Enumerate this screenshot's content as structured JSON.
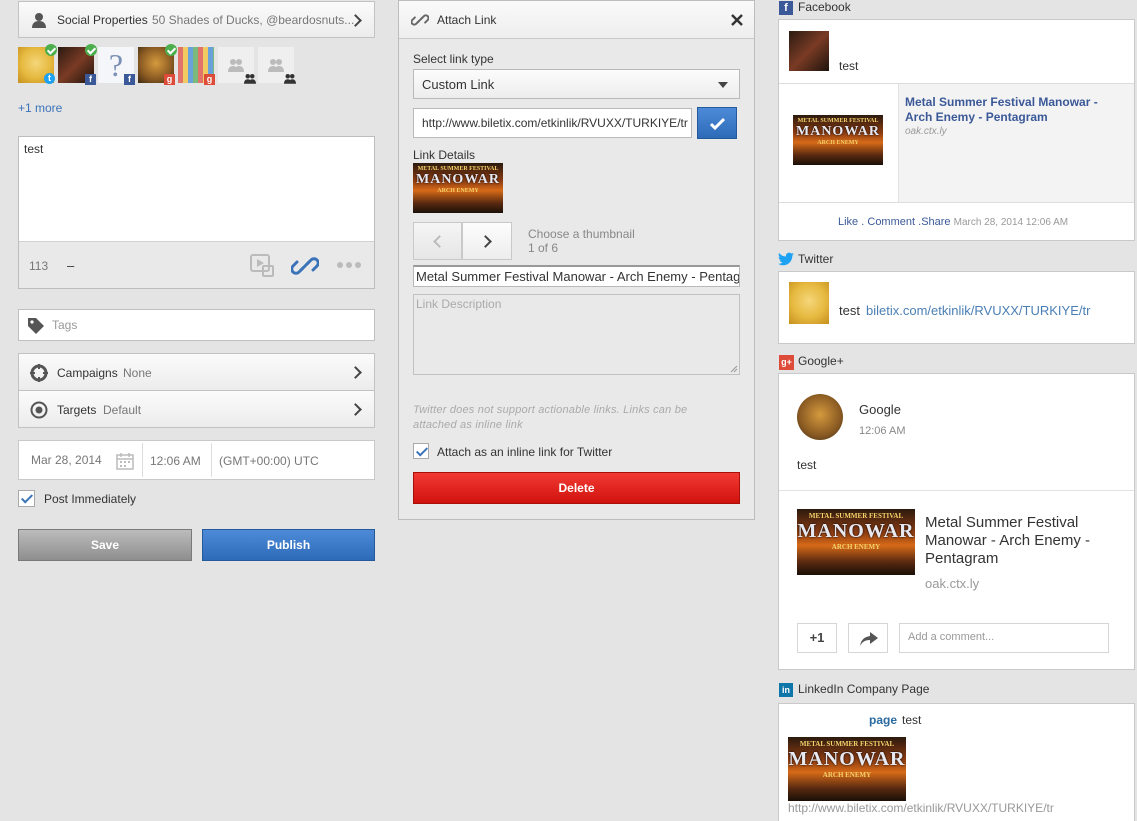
{
  "left": {
    "social_label": "Social Properties",
    "social_value": "50 Shades of Ducks, @beardosnuts...",
    "more_link": "+1 more",
    "message_text": "test",
    "char_count": "113",
    "dash": "–",
    "tags_placeholder": "Tags",
    "campaigns_label": "Campaigns",
    "campaigns_value": "None",
    "targets_label": "Targets",
    "targets_value": "Default",
    "date": "Mar 28, 2014",
    "time": "12:06 AM",
    "timezone": "(GMT+00:00) UTC",
    "post_immediately": "Post Immediately",
    "save": "Save",
    "publish": "Publish"
  },
  "attach": {
    "title": "Attach Link",
    "select_label": "Select link type",
    "select_value": "Custom Link",
    "url": "http://www.biletix.com/etkinlik/RVUXX/TURKIYE/tr",
    "details_label": "Link Details",
    "choose_thumb": "Choose a thumbnail",
    "thumb_count": "1 of 6",
    "link_title": "Metal Summer Festival Manowar - Arch Enemy - Pentagram",
    "desc_placeholder": "Link Description",
    "twitter_note": "Twitter does not support actionable links. Links can be attached as inline link",
    "inline_label": "Attach as an inline link for Twitter",
    "delete": "Delete"
  },
  "poster": {
    "line1": "METAL SUMMER FESTIVAL",
    "line2": "MANOWAR",
    "line3": "ARCH ENEMY"
  },
  "preview": {
    "facebook": {
      "label": "Facebook",
      "post_text": "test",
      "link_title": "Metal Summer Festival Manowar - Arch Enemy - Pentagram",
      "link_domain": "oak.ctx.ly",
      "like": "Like",
      "comment": "Comment",
      "share": "Share",
      "dot": ".",
      "timestamp": "March 28, 2014 12:06 AM"
    },
    "twitter": {
      "label": "Twitter",
      "text": "test",
      "link": "biletix.com/etkinlik/RVUXX/TURKIYE/tr"
    },
    "googleplus": {
      "label": "Google+",
      "name": "Google",
      "time": "12:06 AM",
      "text": "test",
      "link_title": "Metal Summer Festival Manowar - Arch Enemy - Pentagram",
      "domain": "oak.ctx.ly",
      "plus_one": "+1",
      "comment_placeholder": "Add a comment..."
    },
    "linkedin": {
      "label": "LinkedIn Company Page",
      "page": "page",
      "text": "test",
      "url": "http://www.biletix.com/etkinlik/RVUXX/TURKIYE/tr"
    }
  },
  "colors": {
    "accent": "#3b73b9",
    "danger": "#e0201b",
    "facebook": "#3b5998",
    "twitter": "#1da1f2",
    "googleplus": "#dd4b39",
    "linkedin": "#0e76a8"
  }
}
